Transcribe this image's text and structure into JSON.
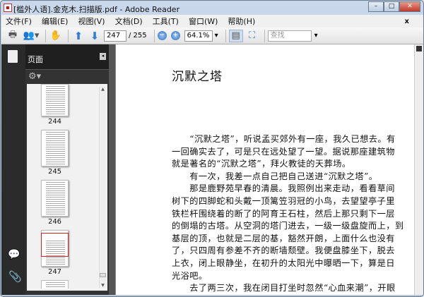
{
  "window": {
    "title": "[槛外人语].金克木.扫描版.pdf - Adobe Reader",
    "minimize": "–",
    "maximize": "□",
    "close": "✕"
  },
  "menu": [
    "文件(F)",
    "编辑(E)",
    "视图(V)",
    "文档(D)",
    "工具(T)",
    "窗口(W)",
    "帮助(H)"
  ],
  "menu_close": "x",
  "toolbar": {
    "page_current": "247",
    "page_total": "/ 255",
    "zoom": "64.1%",
    "find_placeholder": "查找"
  },
  "sidebar": {
    "panel_label": "页面",
    "thumbnails": [
      {
        "page": "244"
      },
      {
        "page": "245"
      },
      {
        "page": "246"
      },
      {
        "page": "247",
        "selected": true
      }
    ]
  },
  "document": {
    "title": "沉默之塔",
    "lines": [
      "　　“沉默之塔”，听说孟买郊外有一座，我久已想去。有",
      "一回确实去了，可是只在远处望了一望。据说那座建筑物",
      "就是著名的“沉默之塔”，拜火教徒的天葬场。",
      "　　有一次，我差一点自己把自己送进“沉默之塔”。",
      "　　那是鹿野苑早春的清晨。我照例出来走动，看看草间",
      "树下的四脚蛇和头戴一顶篱笠羽冠的小鸟，去望望亭子里",
      "铁栏杆围绕着的断了的阿育王石柱，然后上那只剩下一层",
      "的倒塌的古塔。从空洞的塔门进去，一级一级盘旋而上，到",
      "基层的顶，也就是二层的基，豁然开朗，上面什么也没有",
      "了，只四周有参差不齐的断墙颓壁。我便盘膝坐下，脱去",
      "上衣，闭上眼静坐，在初升的太阳光中曝晒一下，算是日",
      "光浴吧。",
      "　　去了两三次，我在闭目打坐时忽然“心血来潮”，开眼"
    ]
  },
  "colors": {
    "selected_thumb": "#d0202a",
    "sidebar_bg": "#2b2b2b"
  }
}
